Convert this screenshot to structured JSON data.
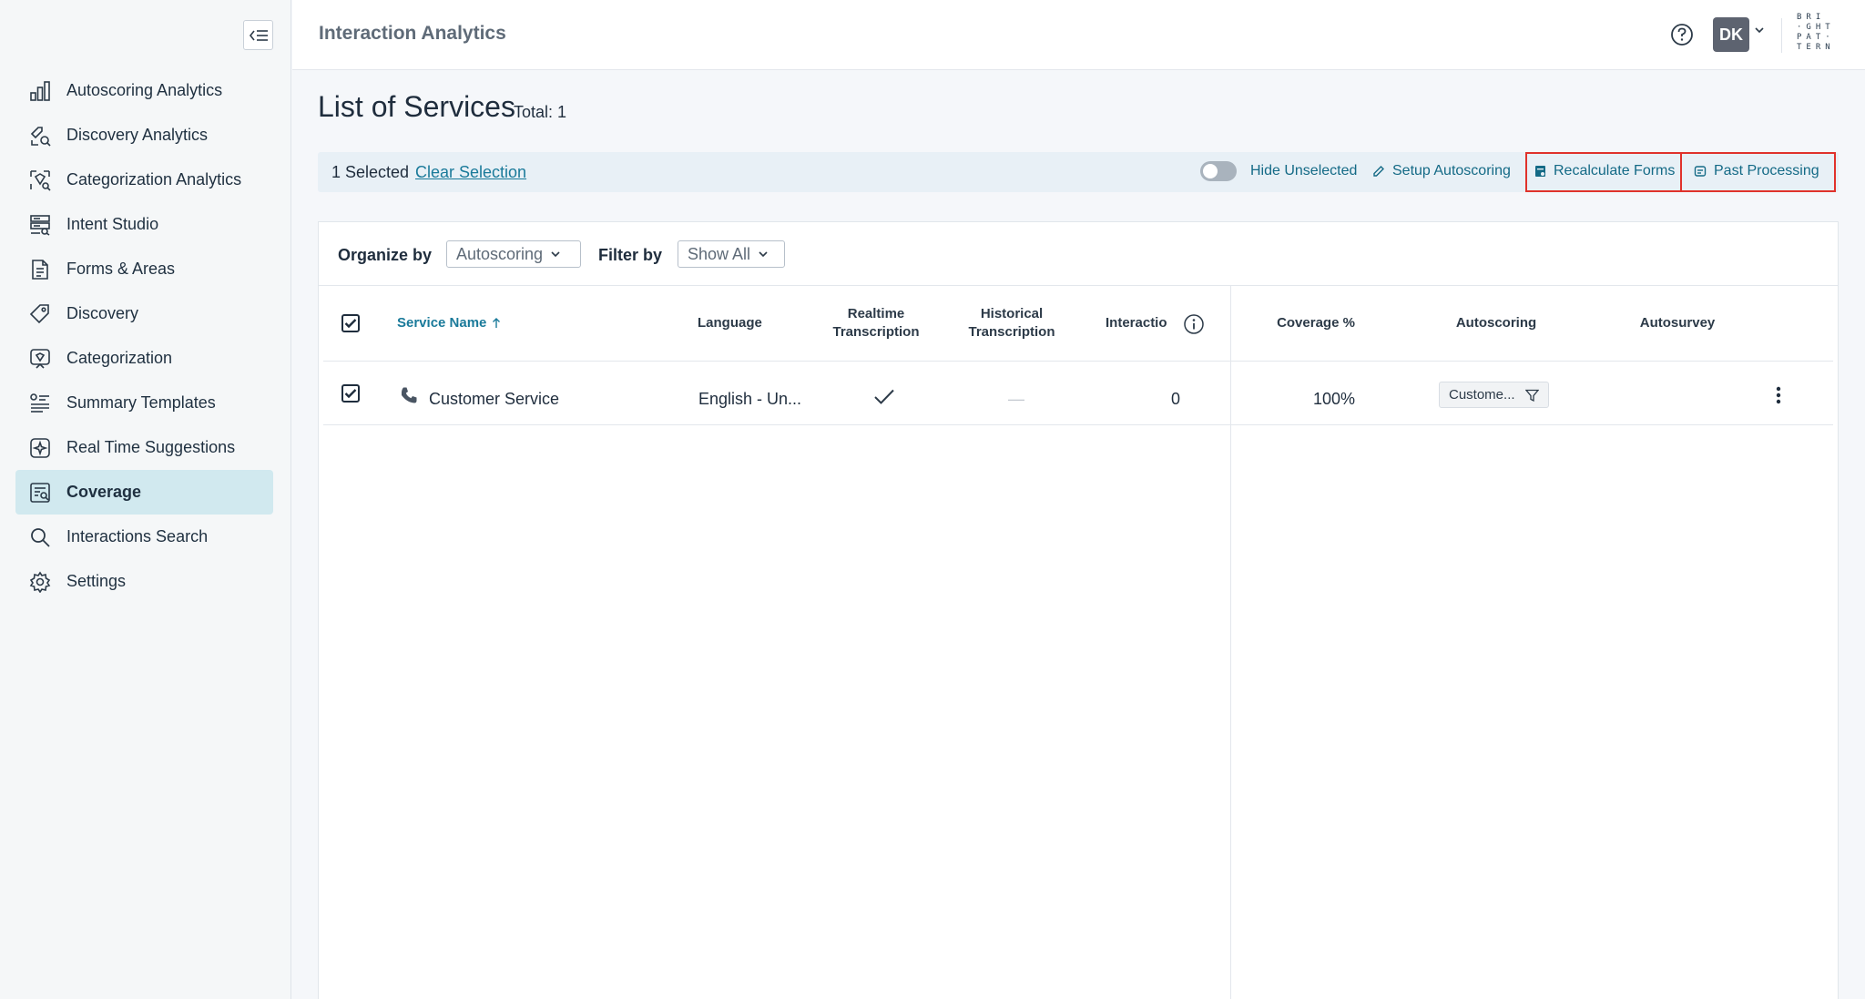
{
  "header": {
    "title": "Interaction Analytics",
    "user_initials": "DK",
    "brand_logo_lines": [
      "BRI",
      "·GHT",
      "PAT·",
      "TERN"
    ]
  },
  "sidebar": {
    "items": [
      {
        "label": "Autoscoring Analytics",
        "icon": "bar-chart-icon"
      },
      {
        "label": "Discovery Analytics",
        "icon": "discovery-analytics-icon"
      },
      {
        "label": "Categorization Analytics",
        "icon": "categorization-analytics-icon"
      },
      {
        "label": "Intent Studio",
        "icon": "intent-studio-icon"
      },
      {
        "label": "Forms & Areas",
        "icon": "forms-icon"
      },
      {
        "label": "Discovery",
        "icon": "tag-icon"
      },
      {
        "label": "Categorization",
        "icon": "categorization-icon"
      },
      {
        "label": "Summary Templates",
        "icon": "summary-templates-icon"
      },
      {
        "label": "Real Time Suggestions",
        "icon": "sparkle-icon"
      },
      {
        "label": "Coverage",
        "icon": "coverage-icon",
        "active": true
      },
      {
        "label": "Interactions Search",
        "icon": "search-icon"
      },
      {
        "label": "Settings",
        "icon": "gear-icon"
      }
    ]
  },
  "main": {
    "title": "List of Services",
    "total": "Total: 1",
    "selection": {
      "count_text": "1 Selected",
      "clear_label": "Clear Selection",
      "hide_unselected_label": "Hide Unselected",
      "setup_label": "Setup Autoscoring",
      "recalculate_label": "Recalculate Forms",
      "past_label": "Past Processing"
    },
    "filters": {
      "organize_label": "Organize by",
      "organize_value": "Autoscoring",
      "filter_label": "Filter by",
      "filter_value": "Show All"
    },
    "table": {
      "columns": {
        "service_name": "Service Name",
        "language": "Language",
        "realtime": "Realtime Transcription",
        "historical": "Historical Transcription",
        "interactions": "Interactio",
        "coverage": "Coverage %",
        "autoscoring": "Autoscoring",
        "autosurvey": "Autosurvey"
      },
      "rows": [
        {
          "service_name": "Customer Service",
          "language": "English - Un...",
          "realtime": "check",
          "historical": "—",
          "interactions": "0",
          "coverage": "100%",
          "autoscoring": "Custome...",
          "autosurvey": ""
        }
      ]
    }
  },
  "colors": {
    "accent": "#146a86",
    "active_nav": "#d1e9ef",
    "highlight_red": "#e0322b"
  }
}
